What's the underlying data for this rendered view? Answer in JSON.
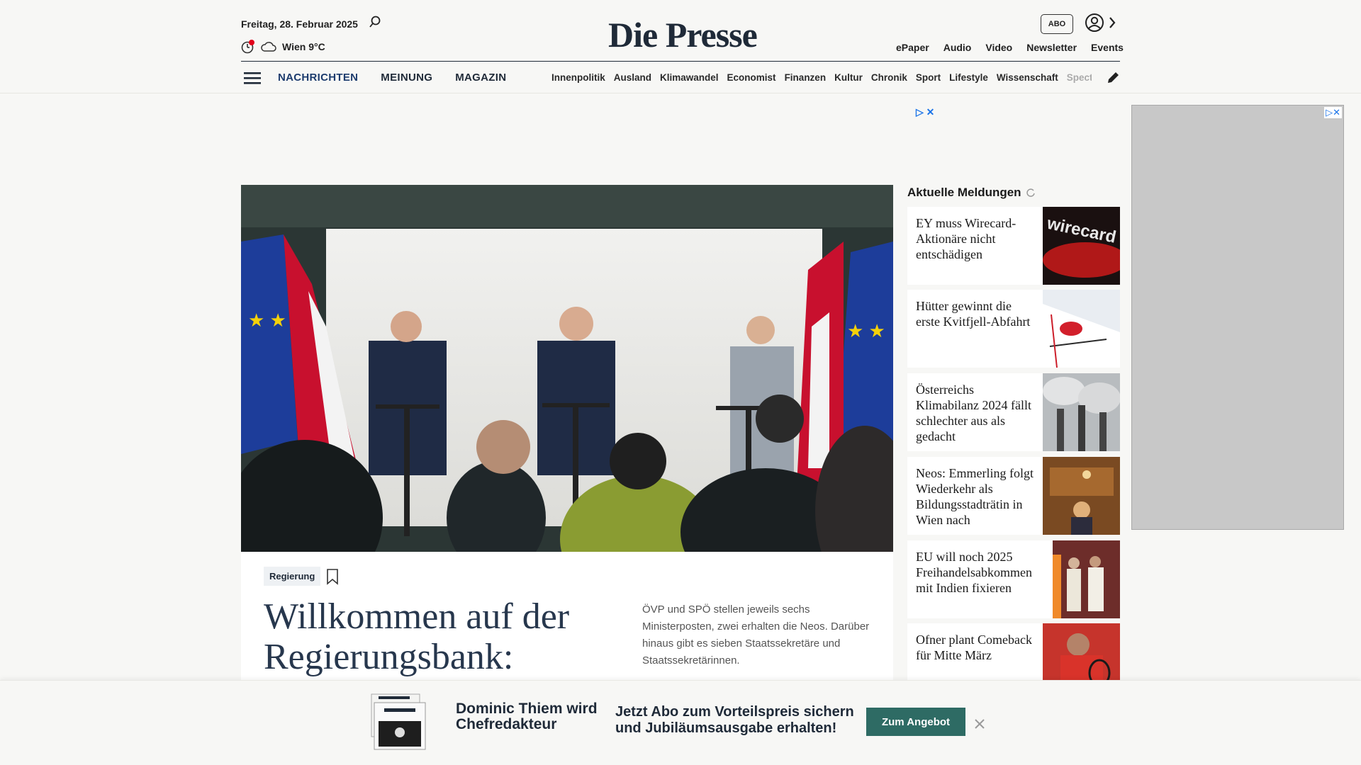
{
  "header": {
    "date": "Freitag, 28. Februar 2025",
    "weather": "Wien 9°C",
    "logo": "Die Presse",
    "abo": "ABO",
    "toplinks": [
      "ePaper",
      "Audio",
      "Video",
      "Newsletter",
      "Events"
    ]
  },
  "nav": {
    "main": [
      "NACHRICHTEN",
      "MEINUNG",
      "MAGAZIN"
    ],
    "sub": [
      "Innenpolitik",
      "Ausland",
      "Klimawandel",
      "Economist",
      "Finanzen",
      "Kultur",
      "Chronik",
      "Sport",
      "Lifestyle",
      "Wissenschaft",
      "Spectrum"
    ]
  },
  "hero": {
    "tag": "Regierung",
    "headline": "Willkommen auf der Regierungsbank:",
    "teaser": "ÖVP und SPÖ stellen jeweils sechs Ministerposten, zwei erhalten die Neos. Darüber hinaus gibt es sieben Staatssekretäre und Staatssekretärinnen."
  },
  "aktuelle": {
    "title": "Aktuelle Meldungen",
    "items": [
      {
        "title": "EY muss Wirecard-Aktionäre nicht entschädigen"
      },
      {
        "title": "Hütter gewinnt die erste Kvitfjell-Abfahrt"
      },
      {
        "title": "Österreichs Klimabilanz 2024 fällt schlechter aus als gedacht"
      },
      {
        "title": "Neos: Emmerling folgt Wiederkehr als Bildungsstadträtin in Wien nach"
      },
      {
        "title": "EU will noch 2025 Freihandelsabkommen mit Indien fixieren"
      },
      {
        "title": "Ofner plant Comeback für Mitte März"
      }
    ],
    "thumb_text_wirecard": "wirecard"
  },
  "banner": {
    "name": "Dominic Thiem wird Chefredakteur",
    "text": "Jetzt Abo zum Vorteilspreis sichern und Jubiläumsausgabe erhalten!",
    "cta": "Zum Angebot"
  },
  "colors": {
    "navy": "#1f2a38",
    "cta_green": "#2e6b64",
    "ad_blue": "#1a73e8"
  }
}
